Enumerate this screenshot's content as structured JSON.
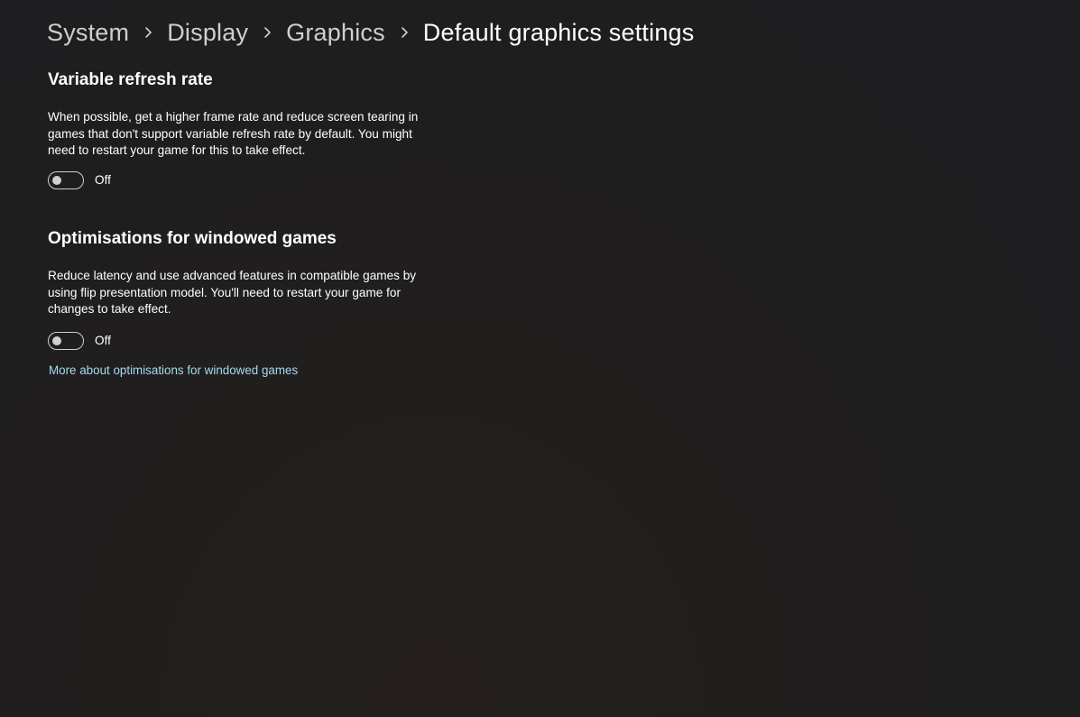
{
  "breadcrumb": {
    "items": [
      "System",
      "Display",
      "Graphics"
    ],
    "current": "Default graphics settings",
    "separator_icon": "chevron-right-icon"
  },
  "vrr": {
    "title": "Variable refresh rate",
    "description_lines": [
      "When possible, get a higher frame rate and reduce screen tearing in",
      "games that don't support variable refresh rate by default. You might",
      "need to restart your game for this to take effect."
    ],
    "toggle_state": "Off"
  },
  "windowed": {
    "title": "Optimisations for windowed games",
    "description_lines": [
      "Reduce latency and use advanced features in compatible games by",
      "using flip presentation model. You'll need to restart your game for",
      "changes to take effect."
    ],
    "toggle_state": "Off",
    "link": "More about optimisations for windowed games"
  },
  "colors": {
    "background": "#201e1e",
    "text": "#ffffff",
    "breadcrumb_inactive": "#cfcfcf",
    "link": "#a4dbf0"
  }
}
